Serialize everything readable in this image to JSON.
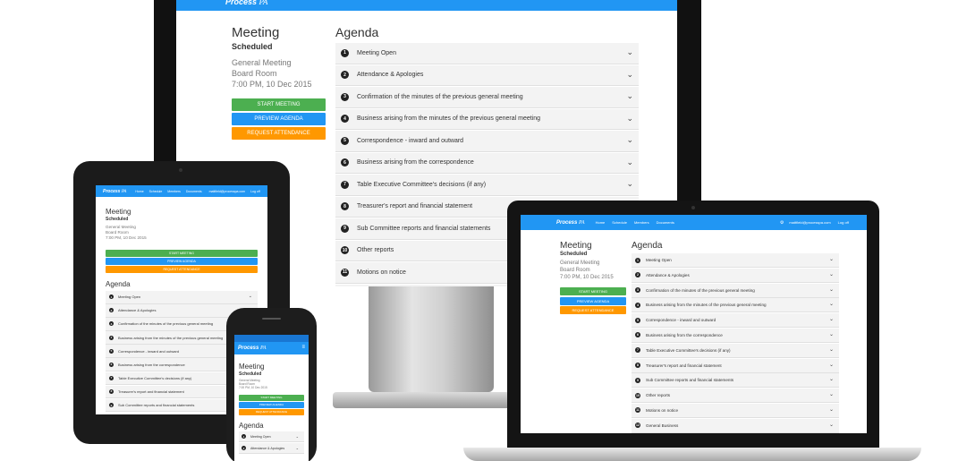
{
  "app": {
    "brand_main": "Process",
    "brand_suffix": "PA",
    "nav": [
      "Home",
      "Schedule",
      "Members",
      "Documents"
    ],
    "user_email": "mattfield@processpa.com",
    "logoff": "Log off"
  },
  "meeting": {
    "title": "Meeting",
    "status": "Scheduled",
    "type": "General Meeting",
    "location": "Board Room",
    "datetime": "7:00 PM, 10 Dec 2015"
  },
  "buttons": {
    "start": "START MEETING",
    "preview": "PREVIEW AGENDA",
    "request": "REQUEST ATTENDANCE"
  },
  "agenda": {
    "title": "Agenda",
    "items": [
      {
        "num": "1",
        "label": "Meeting Open"
      },
      {
        "num": "2",
        "label": "Attendance & Apologies"
      },
      {
        "num": "3",
        "label": "Confirmation of the minutes of the previous general meeting"
      },
      {
        "num": "4",
        "label": "Business arising from the minutes of the previous general meeting"
      },
      {
        "num": "5",
        "label": "Correspondence - inward and outward"
      },
      {
        "num": "6",
        "label": "Business arising from the correspondence"
      },
      {
        "num": "7",
        "label": "Table Executive Committee's decisions (if any)"
      },
      {
        "num": "8",
        "label": "Treasurer's report and financial statement"
      },
      {
        "num": "9",
        "label": "Sub Committee reports and financial statements"
      },
      {
        "num": "10",
        "label": "Other reports"
      },
      {
        "num": "11",
        "label": "Motions on notice"
      },
      {
        "num": "12",
        "label": "General Business"
      }
    ]
  },
  "icons": {
    "expand": "chevron-down-icon",
    "settings": "gear-icon",
    "menu": "hamburger-icon"
  },
  "colors": {
    "primary": "#2196f3",
    "start": "#4caf50",
    "preview": "#2196f3",
    "request": "#ff9800"
  }
}
